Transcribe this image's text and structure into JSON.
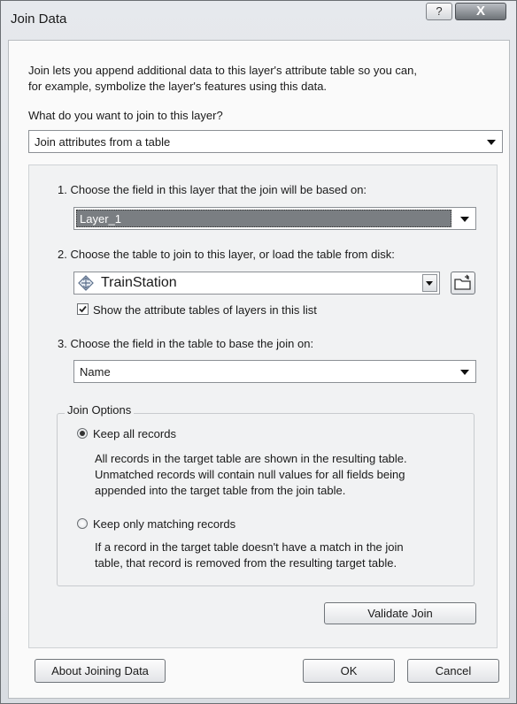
{
  "window": {
    "title": "Join Data",
    "help_glyph": "?",
    "close_glyph": "X"
  },
  "intro": {
    "line1": "Join lets you append additional data to this layer's attribute table so you can,",
    "line2": "for example, symbolize the layer's features using this data."
  },
  "question": "What do you want to join to this layer?",
  "join_type": {
    "value": "Join attributes from a table"
  },
  "step1": {
    "label": "1.  Choose the field in this layer that the join will be based on:",
    "value": "Layer_1"
  },
  "step2": {
    "label": "2.  Choose the table to join to this layer, or load the table from disk:",
    "value": "TrainStation",
    "icon": "table-icon",
    "checkbox_label": "Show the attribute tables of layers in this list",
    "checkbox_checked": true
  },
  "step3": {
    "label": "3.  Choose the field in the table to base the join on:",
    "value": "Name"
  },
  "options": {
    "title": "Join Options",
    "keep_all": {
      "label": "Keep all records",
      "selected": true,
      "desc": [
        "All records in the target table are shown in the resulting table.",
        "Unmatched records will contain null values for all fields being",
        "appended into the target table from the join table."
      ]
    },
    "keep_matching": {
      "label": "Keep only matching records",
      "selected": false,
      "desc": [
        "If a record in the target table doesn't have a match in the join",
        "table, that record is removed from the resulting target table."
      ]
    }
  },
  "buttons": {
    "validate": "Validate Join",
    "about": "About Joining Data",
    "ok": "OK",
    "cancel": "Cancel"
  }
}
